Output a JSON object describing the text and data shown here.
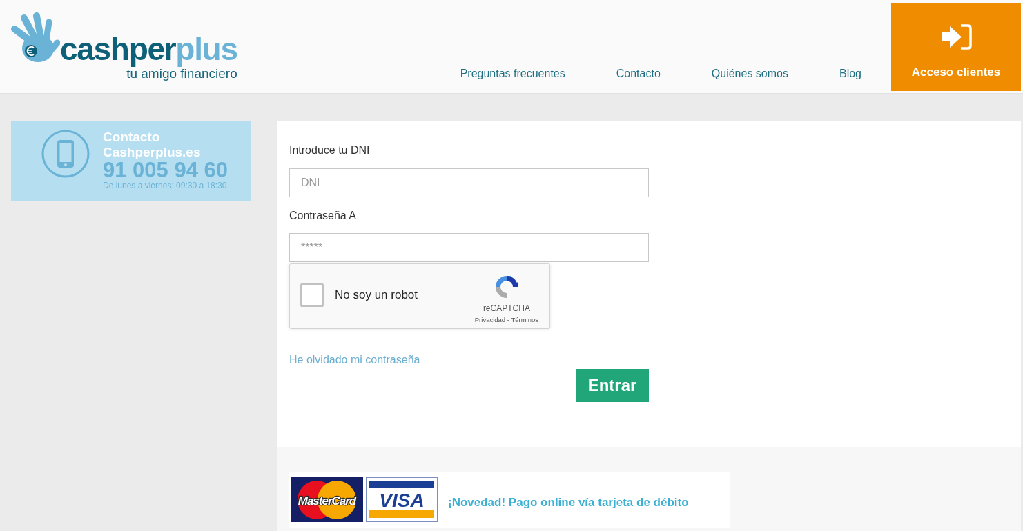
{
  "header": {
    "logo": {
      "brand": [
        "cashper",
        "plus"
      ],
      "tagline": "tu amigo financiero"
    },
    "nav": [
      {
        "label": "Preguntas frecuentes"
      },
      {
        "label": "Contacto"
      },
      {
        "label": "Quiénes somos"
      },
      {
        "label": "Blog"
      }
    ],
    "client_access": {
      "label": "Acceso clientes"
    }
  },
  "contact_card": {
    "title": "Contacto Cashperplus.es",
    "phone": "91 005 94 60",
    "hours": "De lunes a viernes: 09:30 a 18:30"
  },
  "login_form": {
    "fields": [
      {
        "label": "Introduce tu DNI",
        "placeholder": "DNI"
      },
      {
        "label": "Contraseña A",
        "placeholder": "*****"
      }
    ],
    "captcha": {
      "checked": false,
      "label": "No soy un robot",
      "brand": "reCAPTCHA",
      "links": "Privacidad - Términos"
    },
    "forgot_link": "He olvidado mi contraseña",
    "submit": "Entrar"
  },
  "payment_banner": {
    "cards": [
      {
        "kind": "mastercard",
        "label": "MasterCard"
      },
      {
        "kind": "visa",
        "label": "VISA"
      }
    ],
    "text": "¡Novedad! Pago online vía tarjeta de débito"
  }
}
